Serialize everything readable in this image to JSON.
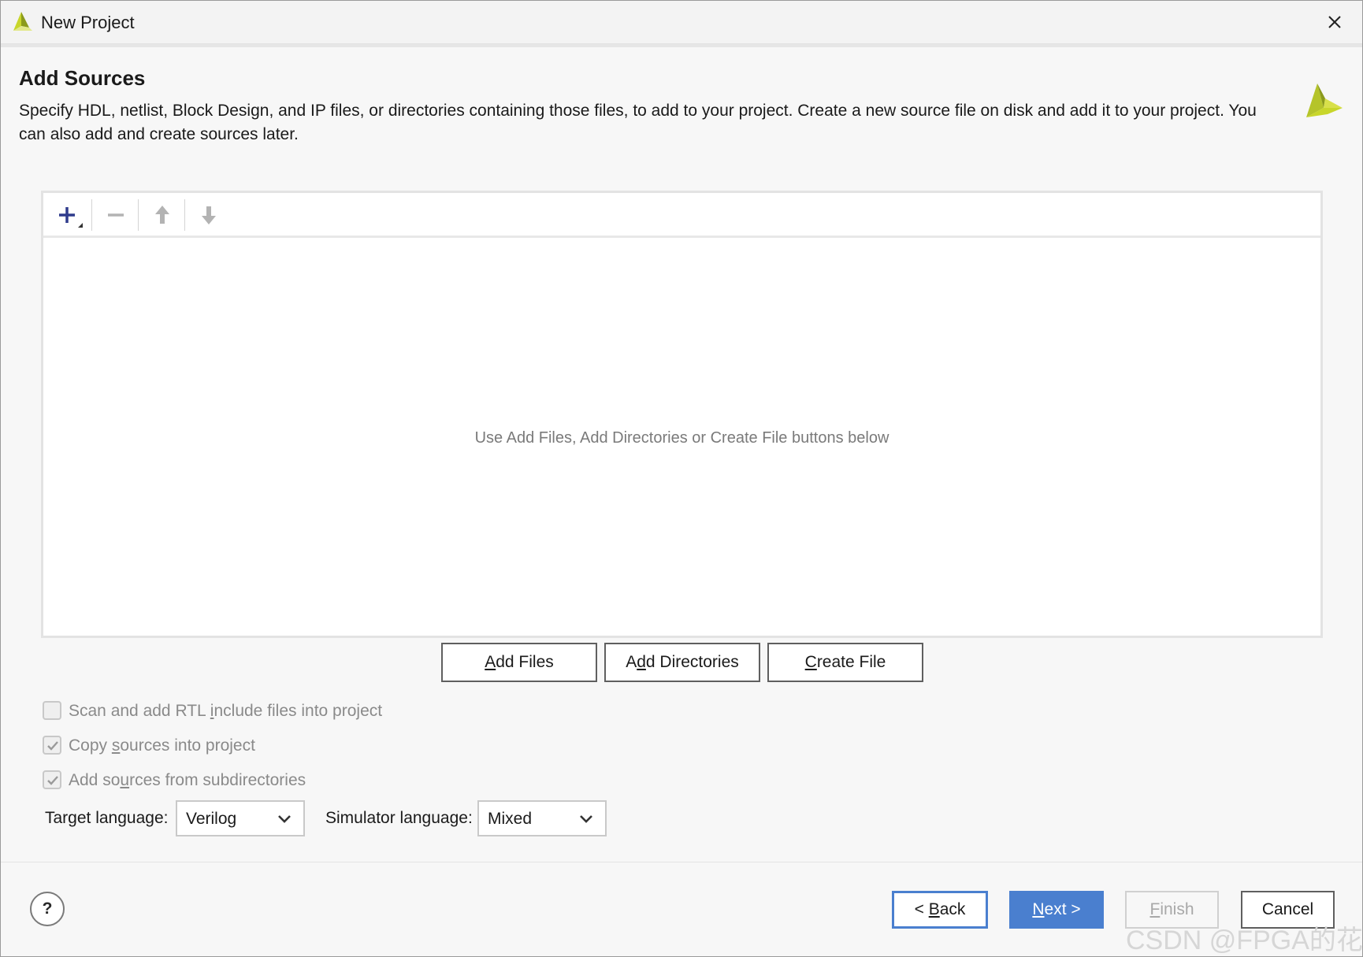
{
  "window": {
    "title": "New Project",
    "app_icon": "vivado-logo-icon",
    "close_icon": "close-icon"
  },
  "page": {
    "heading": "Add Sources",
    "description": "Specify HDL, netlist, Block Design, and IP files, or directories containing those files, to add to your project. Create a new source file on disk and add it to your project. You can also add and create sources later.",
    "logo_icon": "vivado-logo-icon"
  },
  "toolbar": {
    "items": [
      "add-icon",
      "remove-icon",
      "move-up-icon",
      "move-down-icon"
    ]
  },
  "sources": {
    "empty_hint": "Use Add Files, Add Directories or Create File buttons below"
  },
  "actions": {
    "add_files": {
      "pre": "",
      "mnemonic": "A",
      "post": "dd Files"
    },
    "add_directories": {
      "pre": "A",
      "mnemonic": "d",
      "post": "d Directories"
    },
    "create_file": {
      "pre": "",
      "mnemonic": "C",
      "post": "reate File"
    }
  },
  "options": [
    {
      "pre": "Scan and add RTL ",
      "mnemonic": "i",
      "post": "nclude files into project",
      "checked": false
    },
    {
      "pre": "Copy ",
      "mnemonic": "s",
      "post": "ources into project",
      "checked": true
    },
    {
      "pre": "Add so",
      "mnemonic": "u",
      "post": "rces from subdirectories",
      "checked": true
    }
  ],
  "languages": {
    "target_label": "Target language:",
    "target_value": "Verilog",
    "simulator_label": "Simulator language:",
    "simulator_value": "Mixed"
  },
  "footer": {
    "help": "?",
    "back": {
      "pre": "< ",
      "mnemonic": "B",
      "post": "ack"
    },
    "next": {
      "pre": "",
      "mnemonic": "N",
      "post": "ext >"
    },
    "finish": {
      "pre": "",
      "mnemonic": "F",
      "post": "inish"
    },
    "cancel": "Cancel"
  },
  "colors": {
    "accent": "#4a7fcf",
    "logo_light": "#c8d62a",
    "logo_dark": "#8b9a1c",
    "disabled_text": "#8a8a8a"
  },
  "watermark": "CSDN @FPGA的花路"
}
